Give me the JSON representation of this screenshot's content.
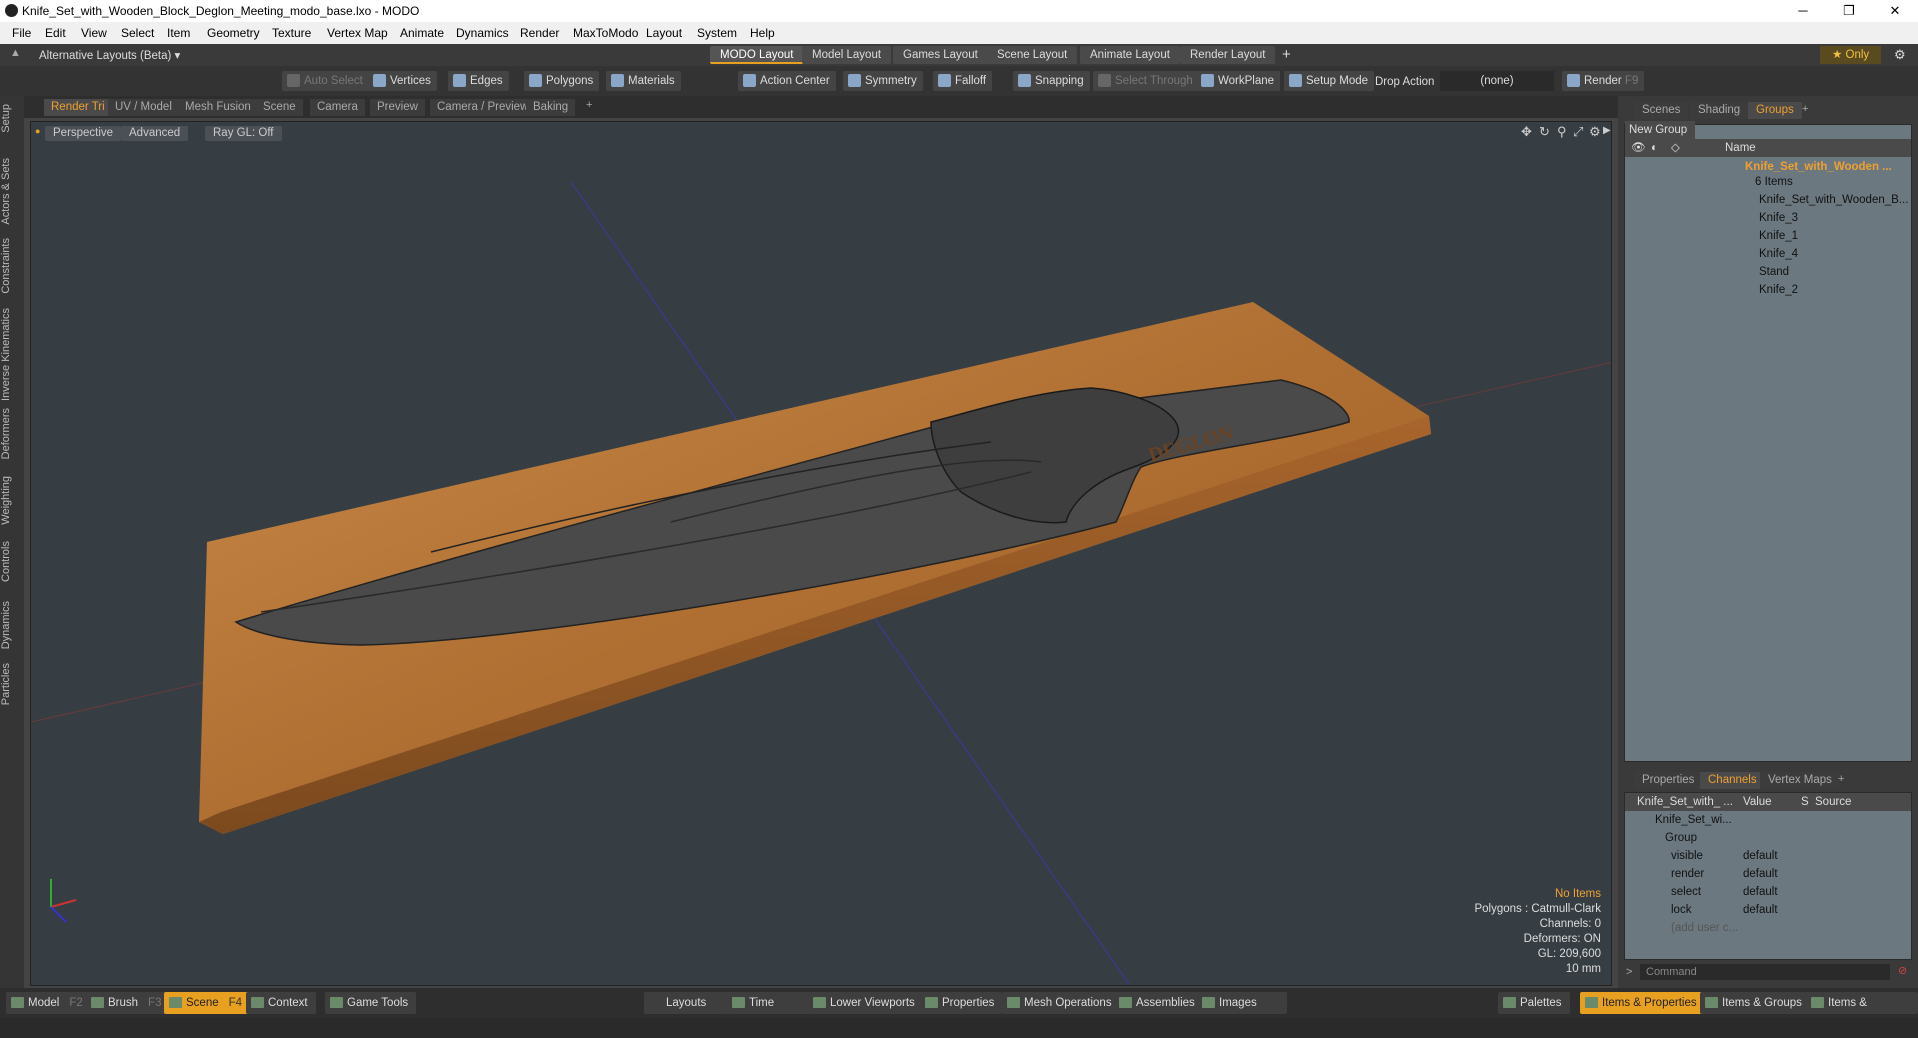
{
  "window": {
    "title": "Knife_Set_with_Wooden_Block_Deglon_Meeting_modo_base.lxo - MODO",
    "min": "─",
    "max": "❐",
    "close": "✕"
  },
  "menu": [
    "File",
    "Edit",
    "View",
    "Select",
    "Item",
    "Geometry",
    "Texture",
    "Vertex Map",
    "Animate",
    "Dynamics",
    "Render",
    "MaxToModo",
    "Layout",
    "System",
    "Help"
  ],
  "layoutbar": {
    "selector": "Alternative Layouts (Beta) ▾",
    "tabs": [
      "MODO Layout",
      "Model Layout",
      "Games Layout",
      "Scene Layout",
      "Animate Layout",
      "Render Layout"
    ],
    "add": "+",
    "only": "★ Only",
    "gear": "⚙"
  },
  "toolbar": [
    "Auto Select",
    "Vertices",
    "Edges",
    "Polygons",
    "Materials",
    "Action Center",
    "Symmetry",
    "Falloff",
    "Snapping",
    "Select Through",
    "WorkPlane",
    "Setup Mode",
    "Drop Action",
    "(none)",
    "Render",
    "F9"
  ],
  "left_tabs": [
    "Setup",
    "Actors & Sets",
    "Constraints",
    "Inverse Kinematics",
    "Deformers",
    "Weighting",
    "Controls",
    "Dynamics",
    "Particles"
  ],
  "viewport_tabs": [
    "Render Tri",
    "UV / Model",
    "Mesh Fusion",
    "Scene",
    "Camera",
    "Preview",
    "Camera / Preview",
    "Baking",
    "+"
  ],
  "viewport": {
    "buttons": [
      "Perspective",
      "Advanced",
      "Ray GL: Off"
    ],
    "logo_text": "DEGLON",
    "info": {
      "items": "No Items",
      "polygons": "Polygons : Catmull-Clark",
      "channels": "Channels: 0",
      "deformers": "Deformers: ON",
      "gl": "GL: 209,600",
      "scale": "10 mm"
    }
  },
  "right": {
    "tabs": [
      "Scenes",
      "Shading",
      "Groups",
      "+"
    ],
    "new_group": "New Group",
    "name_col": "Name",
    "group_name": "Knife_Set_with_Wooden ...",
    "group_count": "6 Items",
    "items": [
      "Knife_Set_with_Wooden_B...",
      "Knife_3",
      "Knife_1",
      "Knife_4",
      "Stand",
      "Knife_2"
    ],
    "lower_tabs": [
      "Properties",
      "Channels",
      "Vertex Maps",
      "+"
    ],
    "channel_cols": [
      "Knife_Set_with_ ...",
      "Value",
      "S",
      "Source"
    ],
    "channel_tree": [
      "Knife_Set_wi...",
      "Group"
    ],
    "channels": [
      {
        "name": "visible",
        "value": "default"
      },
      {
        "name": "render",
        "value": "default"
      },
      {
        "name": "select",
        "value": "default"
      },
      {
        "name": "lock",
        "value": "default"
      }
    ],
    "add_user": "(add user c...",
    "command": "Command"
  },
  "bottom": {
    "left": [
      {
        "label": "Model",
        "key": "F2"
      },
      {
        "label": "Brush",
        "key": "F3"
      },
      {
        "label": "Scene",
        "key": "F4"
      },
      {
        "label": "Context",
        "key": ""
      },
      {
        "label": "Game Tools",
        "key": ""
      }
    ],
    "mid": [
      "Layouts",
      "Time",
      "Lower Viewports",
      "Properties",
      "Mesh Operations",
      "Assemblies",
      "Images"
    ],
    "right": [
      "Palettes",
      "Items & Properties",
      "Items & Groups",
      "Items & Shading"
    ]
  },
  "colors": {
    "accent": "#e8a020",
    "viewport_bg": "#363e44",
    "panel": "#6b7880",
    "wood": "#b9763a",
    "knife": "#4a4a4a"
  }
}
